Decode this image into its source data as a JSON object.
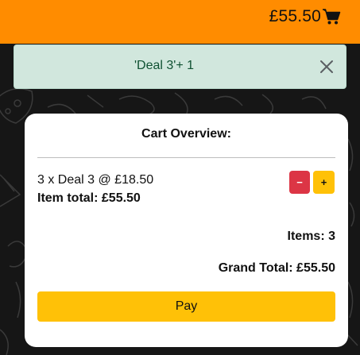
{
  "header": {
    "cart_total": "£55.50",
    "cart_icon": "shopping-cart-icon",
    "background_color": "#ff8c00"
  },
  "toast": {
    "message": "'Deal 3'+ 1",
    "close_icon": "close-icon",
    "background_color": "#d1e7dd",
    "text_color": "#0f5132"
  },
  "cart": {
    "title": "Cart Overview:",
    "items": [
      {
        "line": "3 x Deal 3 @ £18.50",
        "item_total": "Item total: £55.50",
        "decrease_label": "−",
        "increase_label": "+"
      }
    ],
    "items_count": "Items: 3",
    "grand_total": "Grand Total: £55.50",
    "pay_label": "Pay"
  },
  "colors": {
    "minus_button": "#dc3545",
    "plus_button": "#ffc107",
    "pay_button": "#ffc107"
  }
}
